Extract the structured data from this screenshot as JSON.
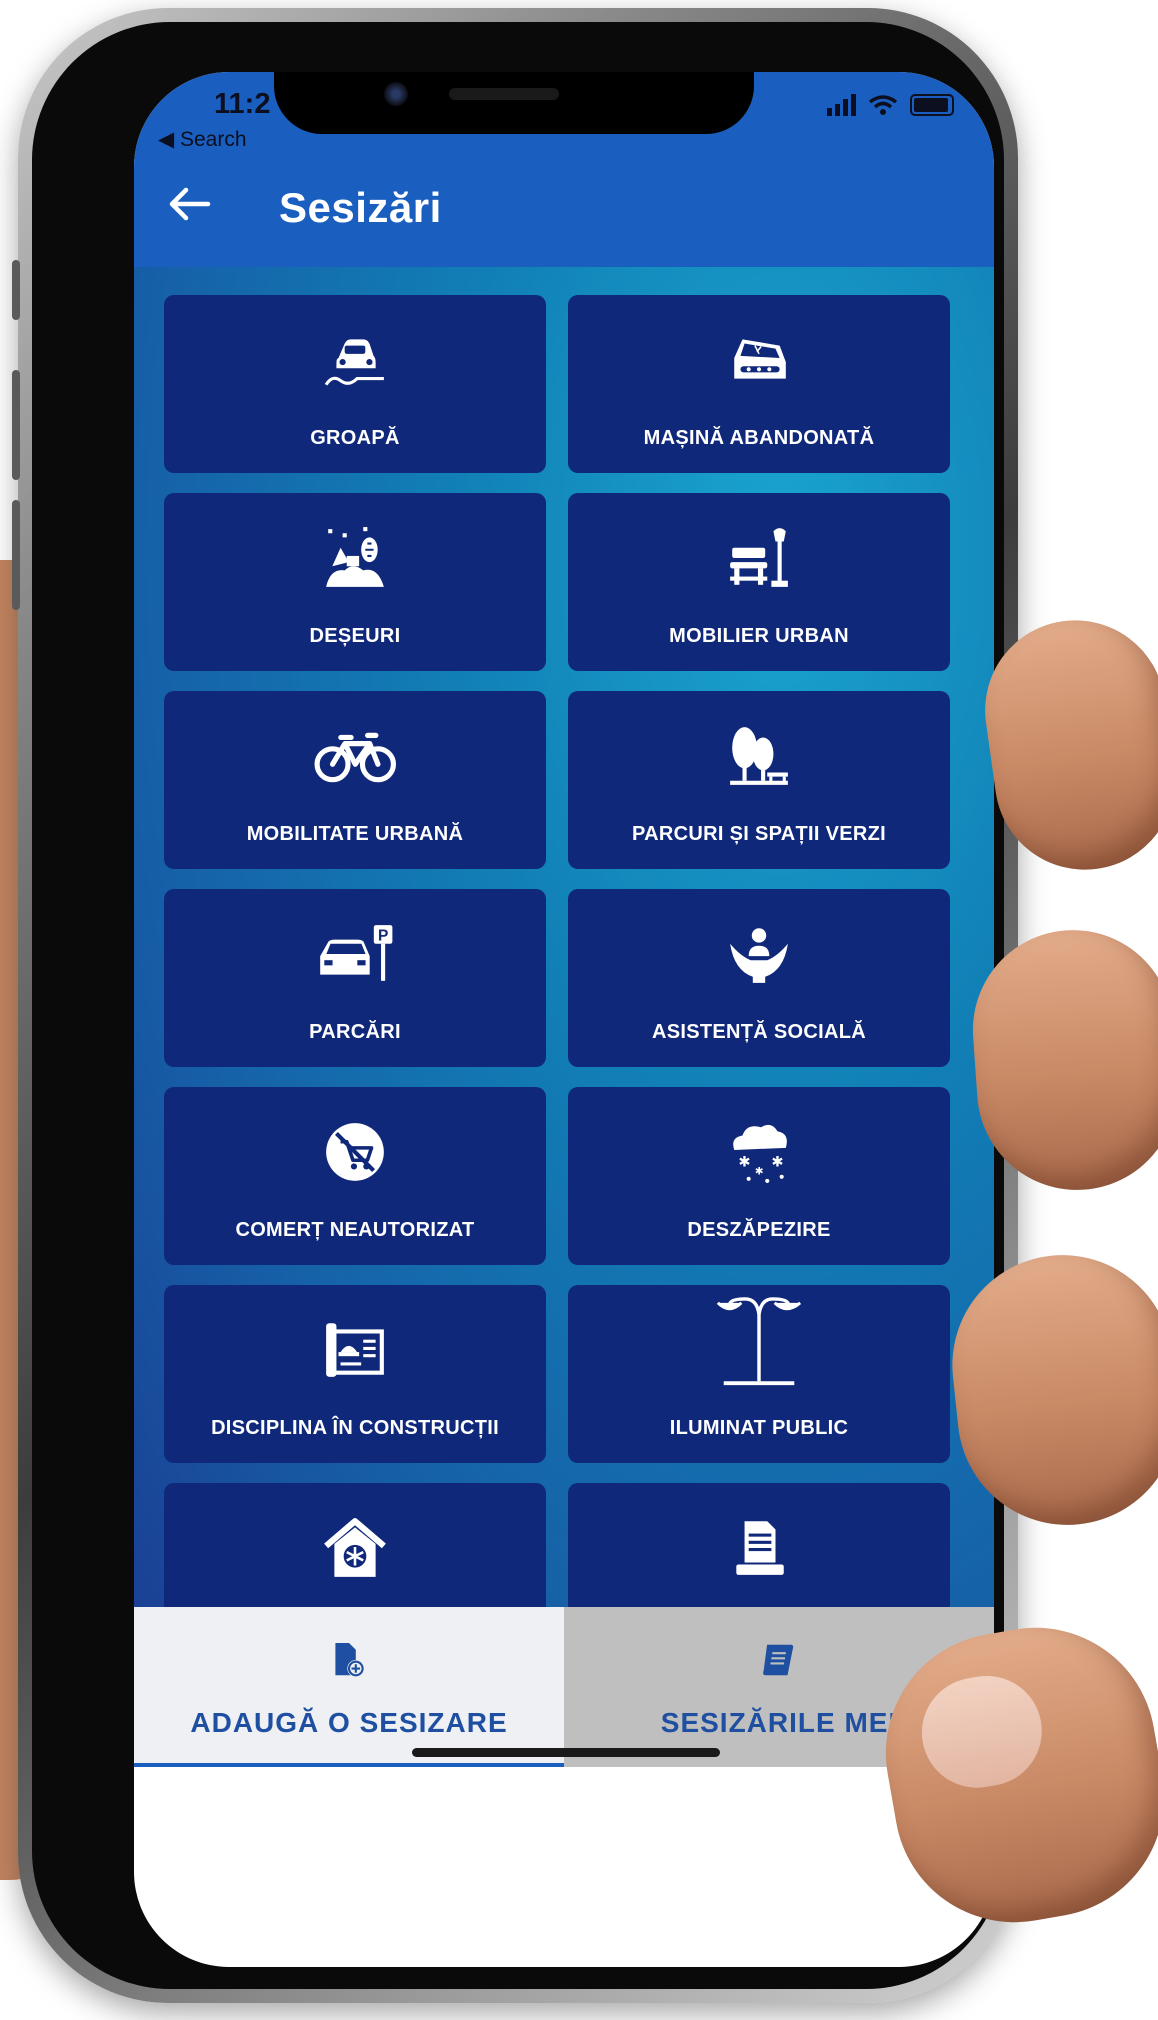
{
  "status": {
    "time": "11:2",
    "back_label": "◀ Search"
  },
  "header": {
    "title": "Sesizări"
  },
  "categories": [
    {
      "label": "GROAPĂ",
      "icon": "pothole-car-icon"
    },
    {
      "label": "MAȘINĂ ABANDONATĂ",
      "icon": "abandoned-car-icon"
    },
    {
      "label": "DEȘEURI",
      "icon": "waste-icon"
    },
    {
      "label": "MOBILIER URBAN",
      "icon": "bench-lamp-icon"
    },
    {
      "label": "MOBILITATE URBANĂ",
      "icon": "bicycle-icon"
    },
    {
      "label": "PARCURI ȘI SPAȚII VERZI",
      "icon": "park-trees-icon"
    },
    {
      "label": "PARCĂRI",
      "icon": "parking-icon"
    },
    {
      "label": "ASISTENȚĂ SOCIALĂ",
      "icon": "social-care-icon"
    },
    {
      "label": "COMERȚ NEAUTORIZAT",
      "icon": "no-trade-icon"
    },
    {
      "label": "DESZĂPEZIRE",
      "icon": "snow-cloud-icon"
    },
    {
      "label": "DISCIPLINA ÎN CONSTRUCȚII",
      "icon": "construction-plan-icon"
    },
    {
      "label": "ILUMINAT PUBLIC",
      "icon": "street-light-icon"
    },
    {
      "label": "",
      "icon": "house-climate-icon"
    },
    {
      "label": "",
      "icon": "document-stand-icon"
    }
  ],
  "tabs": [
    {
      "label": "ADAUGĂ O SESIZARE",
      "icon": "add-report-icon",
      "active": true
    },
    {
      "label": "SESIZĂRILE MEI",
      "icon": "scroll-list-icon",
      "active": false
    }
  ],
  "colors": {
    "header": "#1a5fbf",
    "tile": "#10287a",
    "tab_text": "#1e4fa0"
  }
}
